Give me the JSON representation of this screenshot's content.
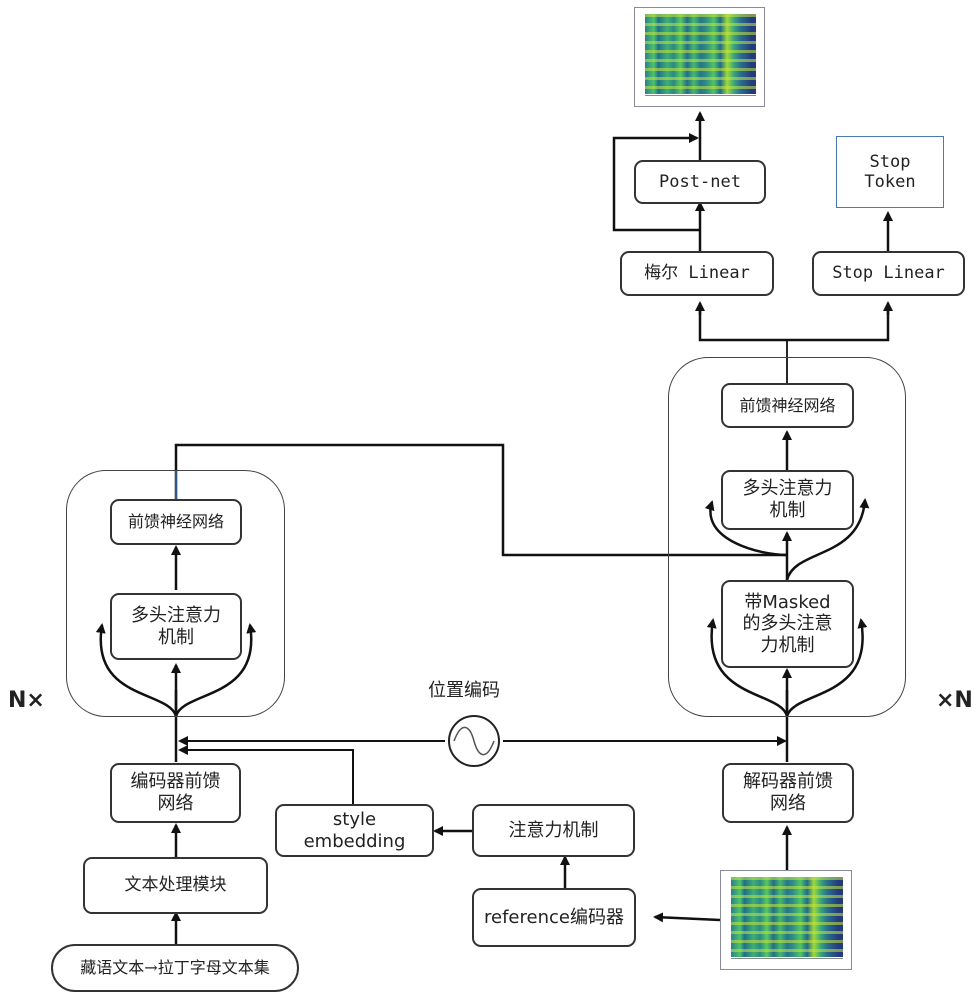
{
  "diagram": {
    "title": "",
    "encoder": {
      "repeat_label": "N×",
      "ffn": "前馈神经网络",
      "attention": "多头注意力机制",
      "pre_ffn": "编码器前馈网络",
      "text_module": "文本处理模块",
      "input": "藏语文本→拉丁字母文本集"
    },
    "positional_encoding": {
      "label": "位置编码",
      "icon": "sine-wave-icon"
    },
    "style": {
      "style_embedding": "style embedding",
      "attention": "注意力机制",
      "reference_encoder": "reference编码器"
    },
    "decoder": {
      "repeat_label": "×N",
      "ffn": "前馈神经网络",
      "attention": "多头注意力机制",
      "masked_attention": "带Masked的多头注意力机制",
      "pre_ffn": "解码器前馈网络"
    },
    "output": {
      "mel_linear": "梅尔 Linear",
      "post_net": "Post-net",
      "stop_linear": "Stop Linear",
      "stop_token": "Stop Token",
      "spectrogram_output": "mel-spectrogram-output",
      "spectrogram_input": "mel-spectrogram-reference"
    },
    "colors": {
      "line": "#111111",
      "box_border": "#333333",
      "stop_token_border": "#4a78b5",
      "highlight_wire": "#3a6fb5"
    }
  }
}
